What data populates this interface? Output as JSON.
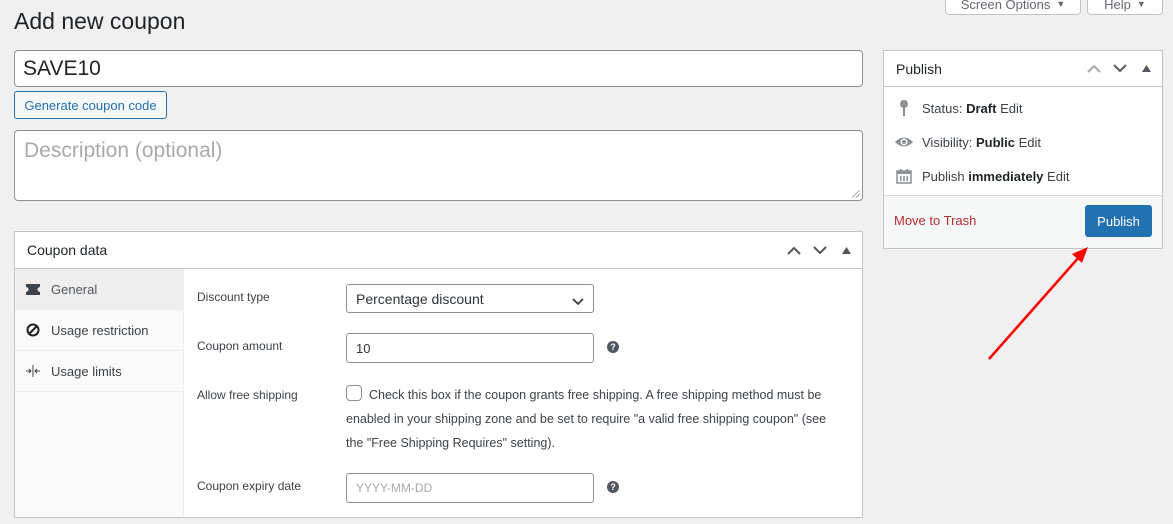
{
  "header": {
    "screen_options_label": "Screen Options",
    "help_label": "Help",
    "page_title": "Add new coupon"
  },
  "coupon": {
    "code_value": "SAVE10",
    "generate_label": "Generate coupon code",
    "description_placeholder": "Description (optional)"
  },
  "coupon_data": {
    "title": "Coupon data",
    "tabs": [
      {
        "label": "General",
        "icon": "ticket-icon",
        "active": true
      },
      {
        "label": "Usage restriction",
        "icon": "prohibited-icon",
        "active": false
      },
      {
        "label": "Usage limits",
        "icon": "limits-icon",
        "active": false
      }
    ],
    "fields": {
      "discount_type": {
        "label": "Discount type",
        "value": "Percentage discount"
      },
      "coupon_amount": {
        "label": "Coupon amount",
        "value": "10"
      },
      "free_shipping": {
        "label": "Allow free shipping",
        "checked": false,
        "description": "Check this box if the coupon grants free shipping. A free shipping method must be enabled in your shipping zone and be set to require \"a valid free shipping coupon\" (see the \"Free Shipping Requires\" setting)."
      },
      "expiry_date": {
        "label": "Coupon expiry date",
        "placeholder": "YYYY-MM-DD"
      }
    },
    "help_glyph": "?"
  },
  "publish": {
    "title": "Publish",
    "status_label": "Status:",
    "status_value": "Draft",
    "visibility_label": "Visibility:",
    "visibility_value": "Public",
    "schedule_label": "Publish",
    "schedule_value": "immediately",
    "edit_label": "Edit",
    "trash_label": "Move to Trash",
    "publish_button": "Publish"
  },
  "colors": {
    "accent": "#2271b1",
    "trash": "#b32d2e",
    "annotation_arrow": "#ff0000",
    "background": "#f0f0f1"
  }
}
